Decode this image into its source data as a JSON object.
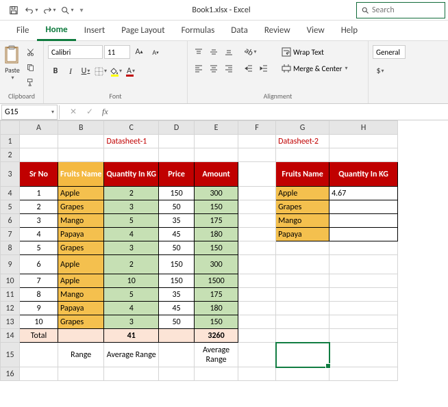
{
  "title": "Book1.xlsx - Excel",
  "search_placeholder": "Search",
  "tabs": {
    "file": "File",
    "home": "Home",
    "insert": "Insert",
    "pagelayout": "Page Layout",
    "formulas": "Formulas",
    "data": "Data",
    "review": "Review",
    "view": "View",
    "help": "Help"
  },
  "ribbon": {
    "paste": "Paste",
    "clipboard": "Clipboard",
    "font_name": "Calibri",
    "font_size": "11",
    "font_group": "Font",
    "align_group": "Alignment",
    "wrap": "Wrap Text",
    "merge": "Merge & Center",
    "num_format": "General"
  },
  "namebox": "G15",
  "fx_label": "fx",
  "cols": [
    "A",
    "B",
    "C",
    "D",
    "E",
    "F",
    "G",
    "H"
  ],
  "ds1_title": "Datasheet-1",
  "ds2_title": "Datasheet-2",
  "hdr1": {
    "srno": "Sr No",
    "fruits": "Fruits Name",
    "qty": "Quantity In KG",
    "price": "Price",
    "amount": "Amount"
  },
  "hdr2": {
    "fruits": "Fruits Name",
    "qty": "Quantity In KG"
  },
  "t1": [
    {
      "sr": "1",
      "fruit": "Apple",
      "qty": "2",
      "price": "150",
      "amt": "300"
    },
    {
      "sr": "2",
      "fruit": "Grapes",
      "qty": "3",
      "price": "50",
      "amt": "150"
    },
    {
      "sr": "3",
      "fruit": "Mango",
      "qty": "5",
      "price": "35",
      "amt": "175"
    },
    {
      "sr": "4",
      "fruit": "Papaya",
      "qty": "4",
      "price": "45",
      "amt": "180"
    },
    {
      "sr": "5",
      "fruit": "Grapes",
      "qty": "3",
      "price": "50",
      "amt": "150"
    },
    {
      "sr": "6",
      "fruit": "Apple",
      "qty": "2",
      "price": "150",
      "amt": "300"
    },
    {
      "sr": "7",
      "fruit": "Apple",
      "qty": "10",
      "price": "150",
      "amt": "1500"
    },
    {
      "sr": "8",
      "fruit": "Mango",
      "qty": "5",
      "price": "35",
      "amt": "175"
    },
    {
      "sr": "9",
      "fruit": "Papaya",
      "qty": "4",
      "price": "45",
      "amt": "180"
    },
    {
      "sr": "10",
      "fruit": "Grapes",
      "qty": "3",
      "price": "50",
      "amt": "150"
    }
  ],
  "t1_total": {
    "label": "Total",
    "qty": "41",
    "amt": "3260"
  },
  "t1_foot": {
    "range": "Range",
    "avg": "Average Range",
    "avg2": "Average Range"
  },
  "t2": [
    {
      "fruit": "Apple",
      "val": "4.67"
    },
    {
      "fruit": "Grapes",
      "val": ""
    },
    {
      "fruit": "Mango",
      "val": ""
    },
    {
      "fruit": "Papaya",
      "val": ""
    }
  ]
}
